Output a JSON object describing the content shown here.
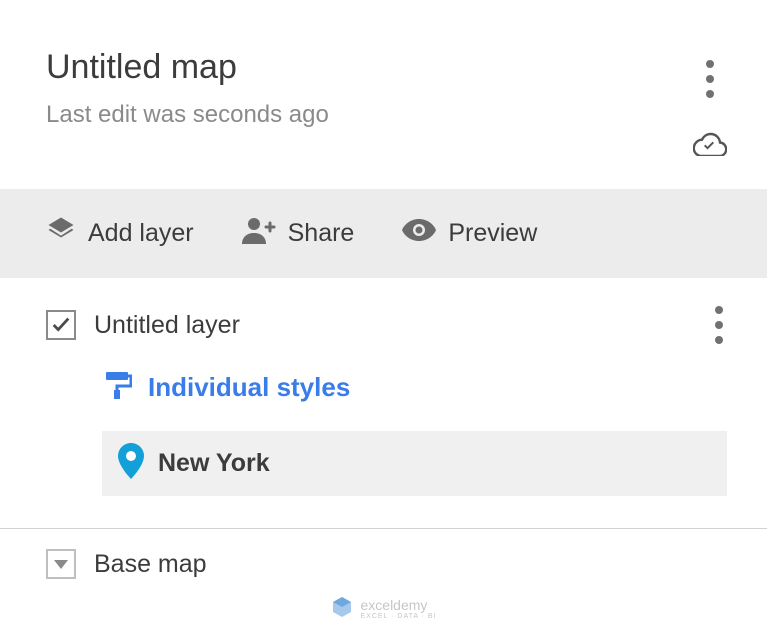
{
  "header": {
    "title": "Untitled map",
    "subtitle": "Last edit was seconds ago"
  },
  "toolbar": {
    "addLayer": "Add layer",
    "share": "Share",
    "preview": "Preview"
  },
  "layer": {
    "title": "Untitled layer",
    "stylesLabel": "Individual styles",
    "placeName": "New York"
  },
  "baseMap": {
    "label": "Base map"
  },
  "colors": {
    "accent": "#3a7ce8",
    "pin": "#139fd7"
  },
  "watermark": {
    "brand": "exceldemy",
    "tag": "EXCEL · DATA · BI"
  }
}
